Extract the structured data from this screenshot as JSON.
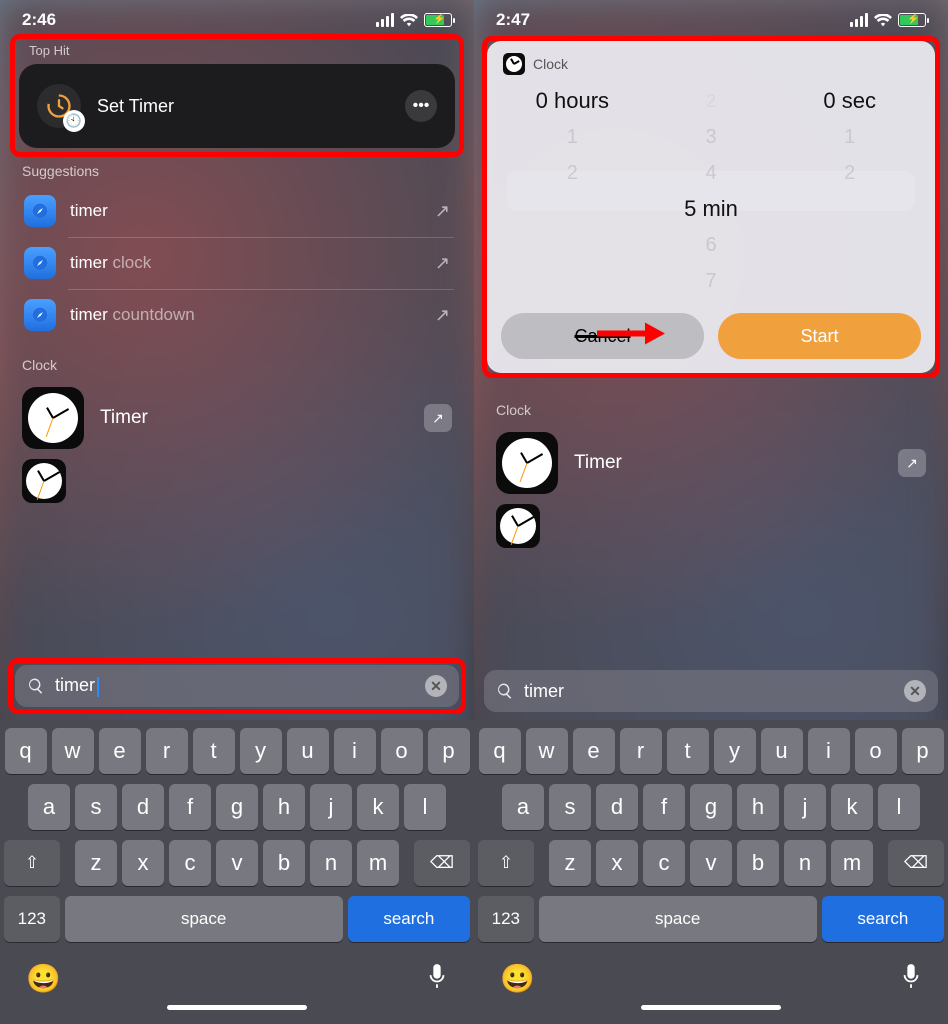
{
  "left": {
    "status_time": "2:46",
    "top_hit_label": "Top Hit",
    "top_hit_title": "Set Timer",
    "suggestions_label": "Suggestions",
    "suggestions": [
      {
        "prefix": "timer",
        "suffix": ""
      },
      {
        "prefix": "timer",
        "suffix": " clock"
      },
      {
        "prefix": "timer",
        "suffix": " countdown"
      }
    ],
    "clock_section_label": "Clock",
    "clock_item": "Timer",
    "search_value": "timer",
    "search_has_cursor": true
  },
  "right": {
    "status_time": "2:47",
    "widget_app": "Clock",
    "picker": {
      "hours": {
        "above": [
          "",
          ""
        ],
        "value": "0",
        "unit": "hours",
        "below": [
          "1",
          "2"
        ]
      },
      "mins": {
        "above": [
          "3",
          "4"
        ],
        "value": "5",
        "unit": "min",
        "below": [
          "6",
          "7"
        ]
      },
      "secs": {
        "above": [
          "",
          ""
        ],
        "value": "0",
        "unit": "sec",
        "below": [
          "1",
          "2"
        ]
      }
    },
    "cancel_label": "Cancel",
    "start_label": "Start",
    "clock_section_label": "Clock",
    "clock_item": "Timer",
    "search_value": "timer",
    "search_has_cursor": false
  },
  "keyboard": {
    "row1": [
      "q",
      "w",
      "e",
      "r",
      "t",
      "y",
      "u",
      "i",
      "o",
      "p"
    ],
    "row2": [
      "a",
      "s",
      "d",
      "f",
      "g",
      "h",
      "j",
      "k",
      "l"
    ],
    "row3": [
      "z",
      "x",
      "c",
      "v",
      "b",
      "n",
      "m"
    ],
    "numbers_key": "123",
    "space_key": "space",
    "search_key": "search"
  }
}
